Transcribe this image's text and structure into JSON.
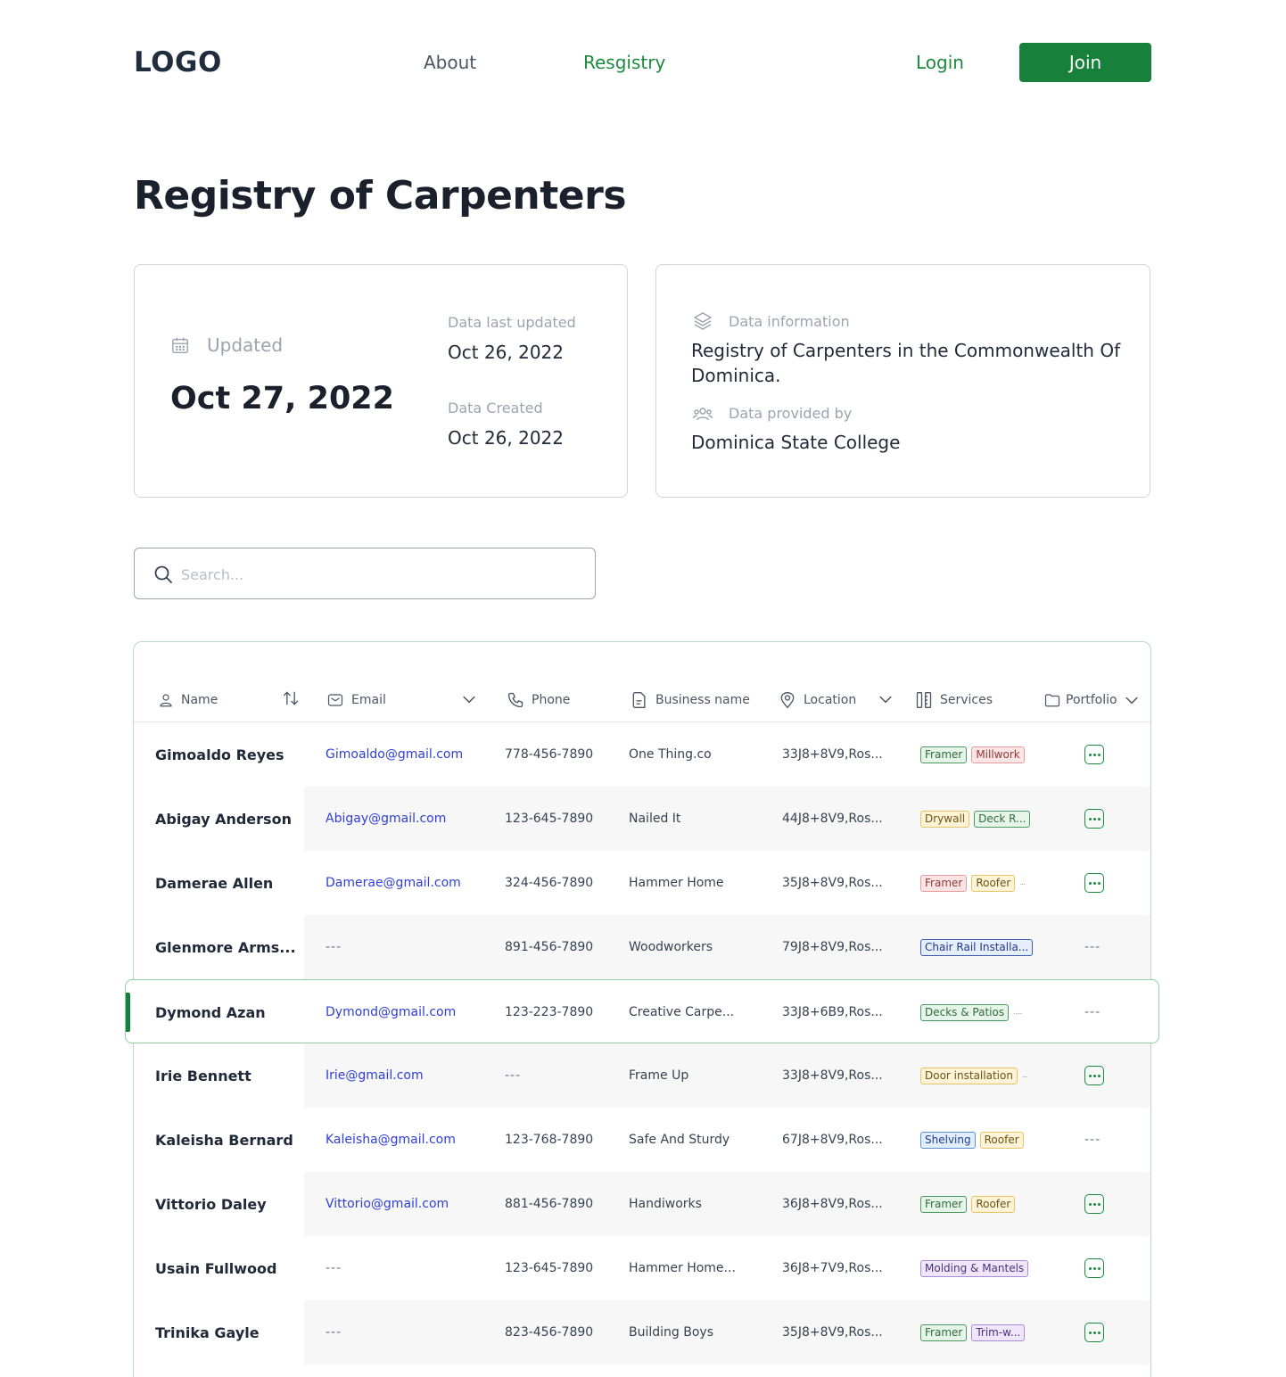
{
  "header": {
    "logo": "LOGO",
    "nav": {
      "about": "About",
      "registry": "Resgistry"
    },
    "login": "Login",
    "join": "Join"
  },
  "page_title": "Registry of Carpenters",
  "updated_card": {
    "label": "Updated",
    "date": "Oct 27, 2022",
    "last_updated_label": "Data last updated",
    "last_updated_value": "Oct 26, 2022",
    "created_label": "Data Created",
    "created_value": "Oct 26, 2022"
  },
  "info_card": {
    "info_label": "Data information",
    "info_text": "Registry of Carpenters in the Commonwealth Of Dominica.",
    "provided_label": "Data provided by",
    "provided_value": "Dominica State College"
  },
  "search": {
    "placeholder": "Search..."
  },
  "table": {
    "headers": {
      "name": "Name",
      "email": "Email",
      "phone": "Phone",
      "business": "Business name",
      "location": "Location",
      "services": "Services",
      "portfolio": "Portfolio"
    },
    "rows": [
      {
        "name": "Gimoaldo Reyes",
        "email": "Gimoaldo@gmail.com",
        "phone": "778-456-7890",
        "business": "One Thing.co",
        "location": "33J8+8V9,Ros...",
        "services": [
          "Framer",
          "Millwork"
        ],
        "more": "",
        "portfolio": true
      },
      {
        "name": "Abigay Anderson",
        "email": "Abigay@gmail.com",
        "phone": "123-645-7890",
        "business": "Nailed It",
        "location": "44J8+8V9,Ros...",
        "services": [
          "Drywall",
          "Deck R..."
        ],
        "more": "",
        "portfolio": true
      },
      {
        "name": "Damerae Allen",
        "email": "Damerae@gmail.com",
        "phone": "324-456-7890",
        "business": "Hammer Home",
        "location": "35J8+8V9,Ros...",
        "services": [
          "Framer",
          "Roofer"
        ],
        "more": "...",
        "portfolio": true
      },
      {
        "name": "Glenmore Arms...",
        "email": "---",
        "phone": "891-456-7890",
        "business": "Woodworkers",
        "location": "79J8+8V9,Ros...",
        "services": [
          "Chair Rail Installa..."
        ],
        "more": "",
        "portfolio": false
      },
      {
        "name": "Dymond Azan",
        "email": "Dymond@gmail.com",
        "phone": "123-223-7890",
        "business": "Creative Carpe...",
        "location": "33J8+6B9,Ros...",
        "services": [
          "Decks & Patios"
        ],
        "more": ".....",
        "portfolio": false
      },
      {
        "name": "Irie Bennett",
        "email": "Irie@gmail.com",
        "phone": "---",
        "business": "Frame Up",
        "location": "33J8+8V9,Ros...",
        "services": [
          "Door installation"
        ],
        "more": "...",
        "portfolio": true
      },
      {
        "name": "Kaleisha Bernard",
        "email": "Kaleisha@gmail.com",
        "phone": "123-768-7890",
        "business": "Safe And Sturdy",
        "location": "67J8+8V9,Ros...",
        "services": [
          "Shelving",
          "Roofer"
        ],
        "more": "",
        "portfolio": false
      },
      {
        "name": "Vittorio Daley",
        "email": "Vittorio@gmail.com",
        "phone": "881-456-7890",
        "business": "Handiworks",
        "location": "36J8+8V9,Ros...",
        "services": [
          "Framer",
          "Roofer"
        ],
        "more": "",
        "portfolio": true
      },
      {
        "name": "Usain Fullwood",
        "email": "---",
        "phone": "123-645-7890",
        "business": "Hammer Home...",
        "location": "36J8+7V9,Ros...",
        "services": [
          "Molding & Mantels"
        ],
        "more": "",
        "portfolio": true
      },
      {
        "name": "Trinika Gayle",
        "email": "---",
        "phone": "823-456-7890",
        "business": "Building Boys",
        "location": "35J8+8V9,Ros...",
        "services": [
          "Framer",
          "Trim-w..."
        ],
        "more": "",
        "portfolio": true
      }
    ],
    "empty_value": "---"
  },
  "tag_colors": {
    "Framer": {
      "bg": "#e6f4e9",
      "border": "#4a9a5f",
      "text": "#2f6b3d"
    },
    "Millwork": {
      "bg": "#fde4e4",
      "border": "#e59b9b",
      "text": "#8b3a3a"
    },
    "Drywall": {
      "bg": "#fdf3d7",
      "border": "#e8c36a",
      "text": "#6b5315"
    },
    "Deck R...": {
      "bg": "#e6f4e9",
      "border": "#4a9a5f",
      "text": "#2f6b3d"
    },
    "Roofer": {
      "bg": "#fdf3d7",
      "border": "#e8c36a",
      "text": "#6b5315"
    },
    "Chair Rail Installa...": {
      "bg": "#e6edfb",
      "border": "#3b5bb5",
      "text": "#1e3a8a"
    },
    "Decks & Patios": {
      "bg": "#e6f4e9",
      "border": "#4a9a5f",
      "text": "#2f6b3d"
    },
    "Door installation": {
      "bg": "#fdf3d7",
      "border": "#e8c36a",
      "text": "#6b5315"
    },
    "Shelving": {
      "bg": "#e3eefc",
      "border": "#5b8fd6",
      "text": "#1e3a8a"
    },
    "Molding & Mantels": {
      "bg": "#efe6fb",
      "border": "#a98ad8",
      "text": "#4c2f7a"
    },
    "Trim-w...": {
      "bg": "#efe6fb",
      "border": "#a98ad8",
      "text": "#4c2f7a"
    }
  },
  "framer_alt": {
    "bg": "#fde4e4",
    "border": "#e59b9b",
    "text": "#8b3a3a"
  },
  "colors": {
    "accent": "#17803a",
    "link": "#2f3ed6"
  }
}
